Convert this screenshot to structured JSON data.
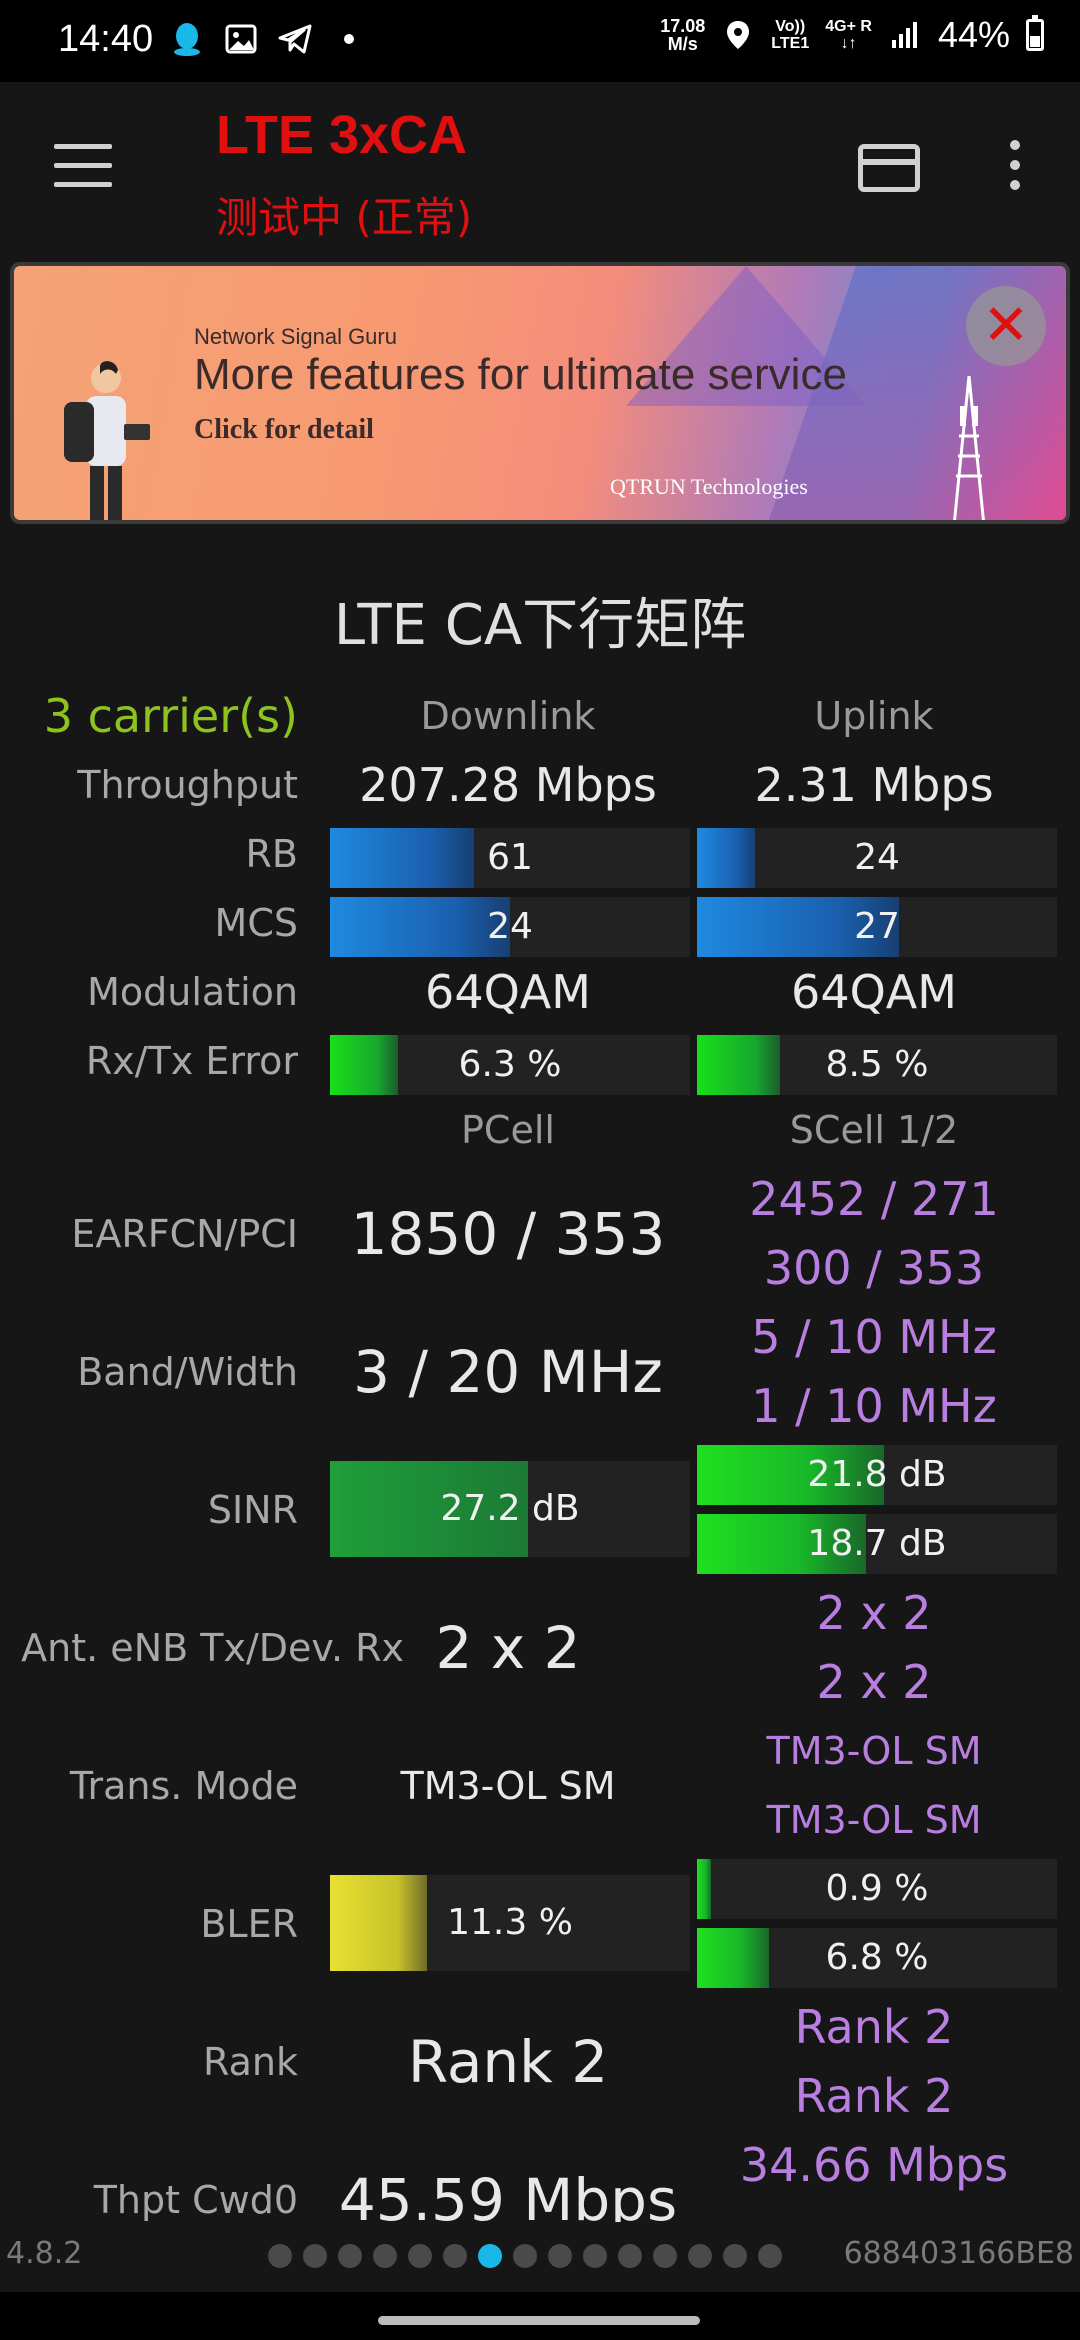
{
  "status_bar": {
    "time": "14:40",
    "left_icons": [
      "qq-icon",
      "gallery-icon",
      "telegram-icon",
      "dot-icon"
    ],
    "speed_value": "17.08",
    "speed_unit": "M/s",
    "volte_label": "Vo))",
    "lte_label": "LTE1",
    "network_label": "4G+",
    "roaming_label": "R",
    "battery": "44%"
  },
  "app_bar": {
    "title": "LTE 3xCA",
    "subtitle": "测试中 (正常)"
  },
  "banner": {
    "brand": "Network Signal Guru",
    "headline": "More features for ultimate service",
    "sub": "Click for detail",
    "company": "QTRUN Technologies",
    "close_symbol": "✕"
  },
  "matrix": {
    "title": "LTE CA下行矩阵",
    "carriers": "3 carrier(s)",
    "downlink_header": "Downlink",
    "uplink_header": "Uplink",
    "throughput_label": "Throughput",
    "throughput_dl": "207.28 Mbps",
    "throughput_ul": "2.31 Mbps",
    "rb_label": "RB",
    "rb_dl": "61",
    "rb_ul": "24",
    "mcs_label": "MCS",
    "mcs_dl": "24",
    "mcs_ul": "27",
    "modulation_label": "Modulation",
    "modulation_dl": "64QAM",
    "modulation_ul": "64QAM",
    "error_label": "Rx/Tx Error",
    "error_dl": "6.3 %",
    "error_ul": "8.5 %",
    "pcell_header": "PCell",
    "scell_header": "SCell 1/2",
    "earfcn_label": "EARFCN/PCI",
    "earfcn_pcell": "1850 / 353",
    "earfcn_scell1": "2452 / 271",
    "earfcn_scell2": "300 / 353",
    "band_label": "Band/Width",
    "band_pcell": "3 / 20 MHz",
    "band_scell1": "5 / 10 MHz",
    "band_scell2": "1 / 10 MHz",
    "sinr_label": "SINR",
    "sinr_pcell": "27.2 dB",
    "sinr_scell1": "21.8 dB",
    "sinr_scell2": "18.7 dB",
    "ant_label": "Ant. eNB Tx/Dev. Rx",
    "ant_pcell": "2 x 2",
    "ant_scell1": "2 x 2",
    "ant_scell2": "2 x 2",
    "tm_label": "Trans. Mode",
    "tm_pcell": "TM3-OL SM",
    "tm_scell1": "TM3-OL SM",
    "tm_scell2": "TM3-OL SM",
    "bler_label": "BLER",
    "bler_pcell": "11.3 %",
    "bler_scell1": "0.9 %",
    "bler_scell2": "6.8 %",
    "rank_label": "Rank",
    "rank_pcell": "Rank 2",
    "rank_scell1": "Rank 2",
    "rank_scell2": "Rank 2",
    "thpt_label": "Thpt Cwd0",
    "thpt_pcell": "45.59 Mbps",
    "thpt_scell1": "34.66 Mbps"
  },
  "bar_levels": {
    "rb_dl": 0.4,
    "rb_ul": 0.16,
    "mcs_dl": 0.5,
    "mcs_ul": 0.56,
    "error_dl": 0.19,
    "error_ul": 0.23,
    "sinr_pcell": 0.55,
    "sinr_scell1": 0.52,
    "sinr_scell2": 0.47,
    "bler_pcell": 0.27,
    "bler_scell1": 0.04,
    "bler_scell2": 0.2
  },
  "footer": {
    "version": "4.8.2",
    "device_id": "688403166BE8",
    "page_count": 15,
    "active_page": 7
  },
  "colors": {
    "title_red": "#e01010",
    "carrier_green": "#8dc21f",
    "scell_purple": "#b87fe0",
    "page_dot_active": "#19b8e8"
  }
}
